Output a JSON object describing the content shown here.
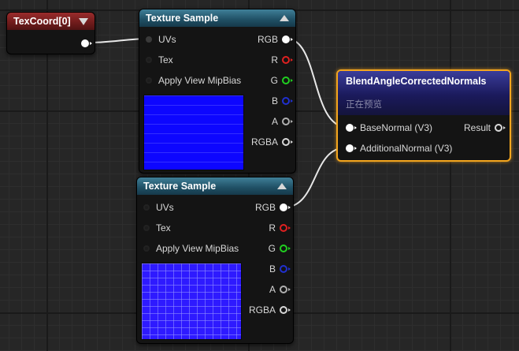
{
  "canvas": {
    "background": "#262626"
  },
  "texcoord_node": {
    "title": "TexCoord[0]",
    "header_color": "#8a2323"
  },
  "texture_sample_1": {
    "title": "Texture Sample",
    "inputs": [
      "UVs",
      "Tex",
      "Apply View MipBias"
    ],
    "outputs": [
      {
        "label": "RGB",
        "pin_color": "#ffffff",
        "connected": true
      },
      {
        "label": "R",
        "pin_color": "#e02020",
        "connected": false
      },
      {
        "label": "G",
        "pin_color": "#20d020",
        "connected": false
      },
      {
        "label": "B",
        "pin_color": "#2030d0",
        "connected": false
      },
      {
        "label": "A",
        "pin_color": "#b0b0b0",
        "connected": false
      },
      {
        "label": "RGBA",
        "pin_color": "#d8d8d8",
        "connected": false
      }
    ]
  },
  "texture_sample_2": {
    "title": "Texture Sample",
    "inputs": [
      "UVs",
      "Tex",
      "Apply View MipBias"
    ],
    "outputs": [
      {
        "label": "RGB",
        "pin_color": "#ffffff",
        "connected": true
      },
      {
        "label": "R",
        "pin_color": "#e02020",
        "connected": false
      },
      {
        "label": "G",
        "pin_color": "#20d020",
        "connected": false
      },
      {
        "label": "B",
        "pin_color": "#2030d0",
        "connected": false
      },
      {
        "label": "A",
        "pin_color": "#b0b0b0",
        "connected": false
      },
      {
        "label": "RGBA",
        "pin_color": "#d8d8d8",
        "connected": false
      }
    ]
  },
  "blend_node": {
    "title": "BlendAngleCorrectedNormals",
    "subtitle": "正在预览",
    "inputs": [
      "BaseNormal (V3)",
      "AdditionalNormal (V3)"
    ],
    "output": "Result",
    "highlight_color": "#f3a51e"
  },
  "icons": [
    "collapse-arrow-icon",
    "expand-arrow-icon",
    "pin-icon"
  ]
}
